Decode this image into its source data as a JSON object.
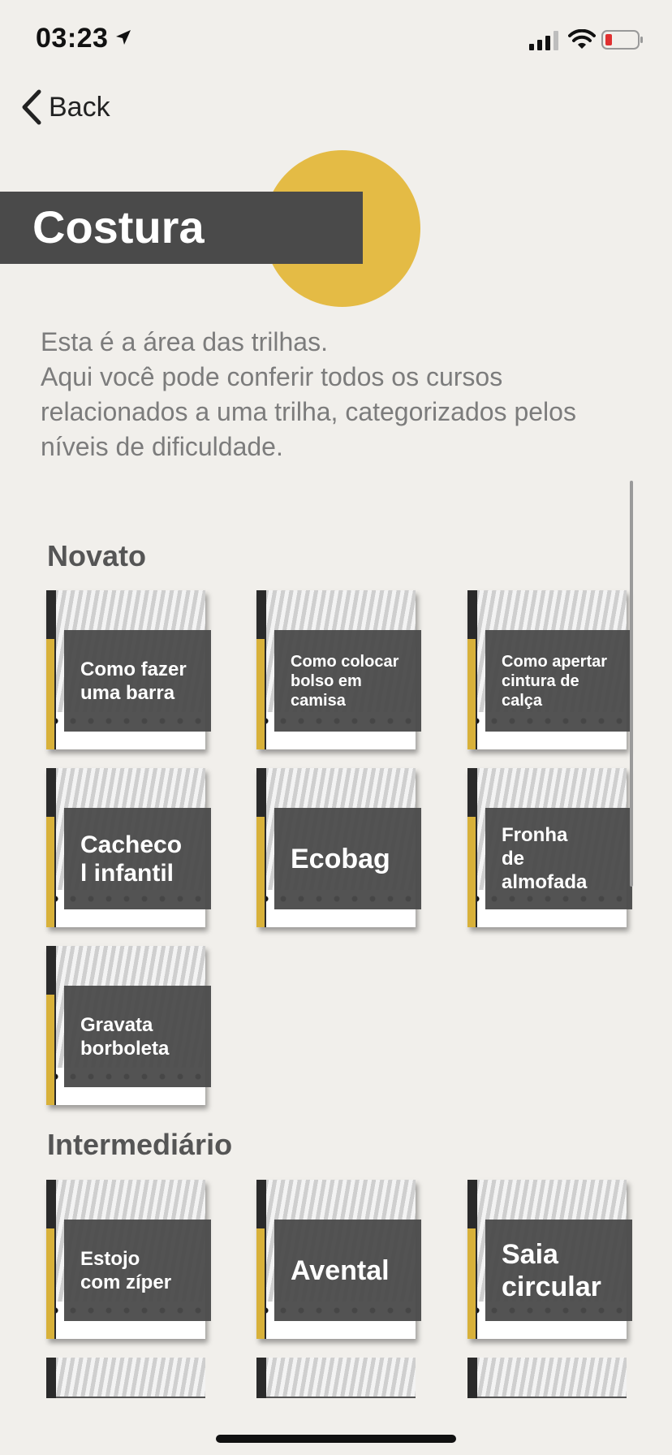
{
  "status": {
    "time": "03:23"
  },
  "nav": {
    "back_label": "Back"
  },
  "header": {
    "title": "Costura"
  },
  "description": "Esta é a área das trilhas.\nAqui você pode conferir todos os cursos relacionados a uma trilha, categorizados pelos níveis de dificuldade.",
  "sections": [
    {
      "title": "Novato",
      "courses": [
        {
          "label": "Como fazer\numa barra"
        },
        {
          "label": "Como colocar\nbolso em\ncamisa"
        },
        {
          "label": "Como apertar\ncintura de\ncalça"
        },
        {
          "label": "Cacheco\nl infantil"
        },
        {
          "label": "Ecobag"
        },
        {
          "label": "Fronha\nde\nalmofada"
        },
        {
          "label": "Gravata\nborboleta"
        }
      ]
    },
    {
      "title": "Intermediário",
      "courses": [
        {
          "label": "Estojo\ncom zíper"
        },
        {
          "label": "Avental"
        },
        {
          "label": "Saia\ncircular"
        }
      ]
    }
  ],
  "colors": {
    "accent_yellow": "#e4bb45",
    "title_bar": "#4a4a4a",
    "background": "#f1efeb"
  }
}
